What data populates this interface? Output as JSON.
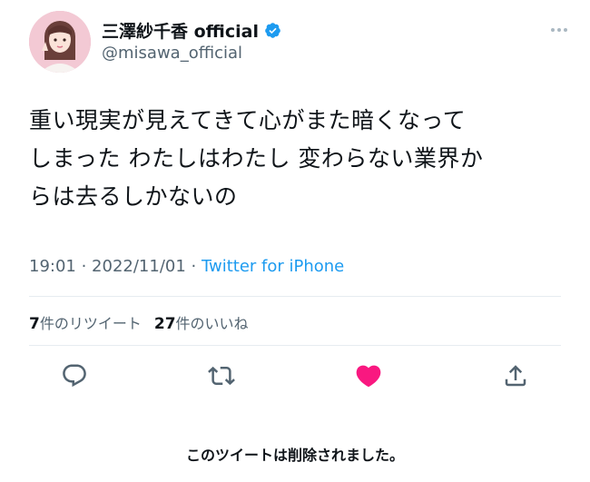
{
  "user": {
    "display_name": "三澤紗千香 official",
    "handle": "@misawa_official",
    "verified": true,
    "avatar_icon": "avatar-photo"
  },
  "tweet": {
    "text": "重い現実が見えてきて心がまた暗くなって\nしまった わたしはわたし 変わらない業界か\nらは去るしかないの",
    "time": "19:01",
    "separator1": " · ",
    "date": "2022/11/01",
    "separator2": " · ",
    "source": "Twitter for iPhone"
  },
  "stats": {
    "retweets_count": "7",
    "retweets_label": "件のリツイート",
    "likes_count": "27",
    "likes_label": "件のいいね"
  },
  "actions": {
    "reply_icon": "reply-icon",
    "retweet_icon": "retweet-icon",
    "like_icon": "heart-icon",
    "share_icon": "share-icon",
    "like_color": "#f91880",
    "icon_color": "#536471"
  },
  "notice": {
    "deleted_text": "このツイートは削除されました。"
  },
  "colors": {
    "link": "#1d9bf0",
    "verified": "#1d9bf0",
    "secondary_text": "#536471",
    "divider": "#e6ecf0"
  }
}
